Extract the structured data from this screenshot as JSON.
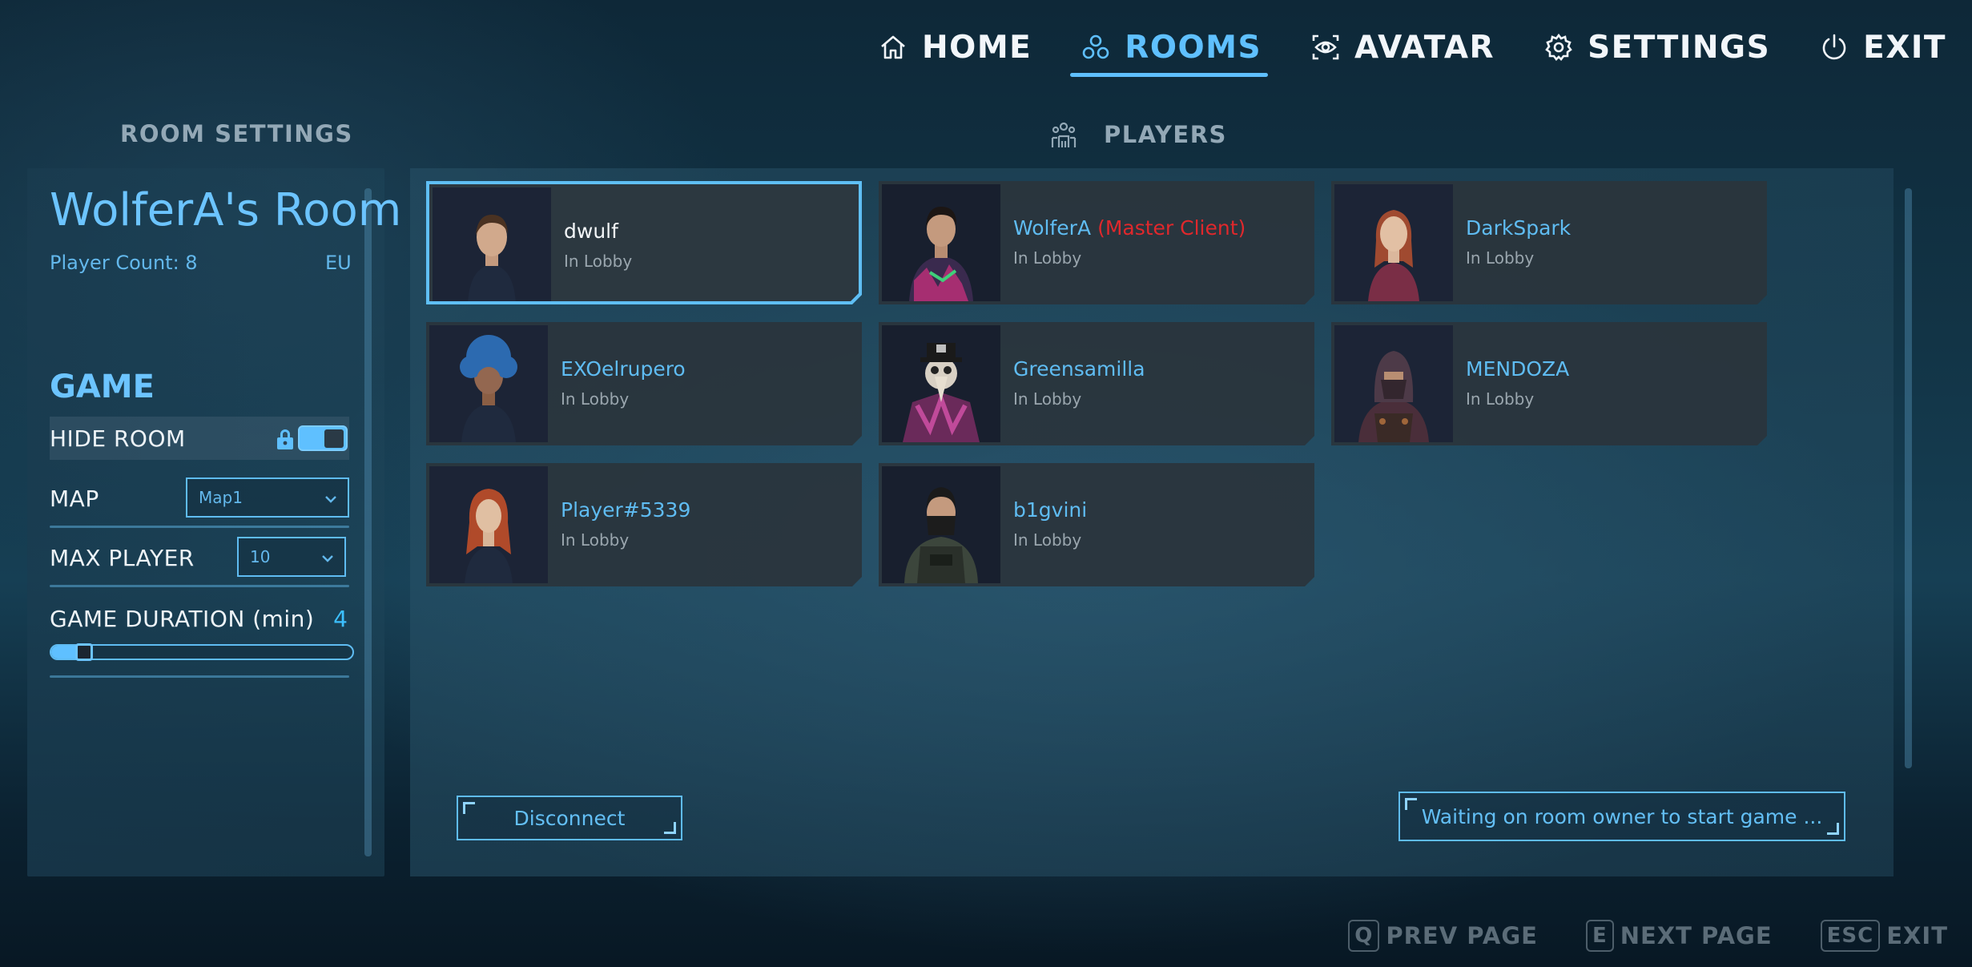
{
  "nav": {
    "items": [
      {
        "label": "HOME",
        "icon": "home-icon",
        "active": false
      },
      {
        "label": "ROOMS",
        "icon": "rooms-icon",
        "active": true
      },
      {
        "label": "AVATAR",
        "icon": "avatar-eye-icon",
        "active": false
      },
      {
        "label": "SETTINGS",
        "icon": "gear-icon",
        "active": false
      },
      {
        "label": "EXIT",
        "icon": "power-icon",
        "active": false
      }
    ],
    "accent_color": "#5fc0ff"
  },
  "room_settings": {
    "section_title": "ROOM SETTINGS",
    "room_name": "WolferA's Room",
    "player_count": "Player Count: 8",
    "region": "EU",
    "game_title": "GAME",
    "hide_room": {
      "label": "HIDE ROOM",
      "enabled": true,
      "locked": true
    },
    "map": {
      "label": "MAP",
      "value": "Map1"
    },
    "max_player": {
      "label": "MAX PLAYER",
      "value": "10"
    },
    "game_duration": {
      "label": "GAME DURATION (min)",
      "value": "4",
      "slider_fraction": 0.08
    }
  },
  "players": {
    "section_title": "PLAYERS",
    "list": [
      {
        "name": "dwulf",
        "status": "In Lobby",
        "tag": "",
        "selected": true
      },
      {
        "name": "WolferA",
        "status": "In Lobby",
        "tag": "(Master Client)",
        "selected": false
      },
      {
        "name": "DarkSpark",
        "status": "In Lobby",
        "tag": "",
        "selected": false
      },
      {
        "name": "EXOelrupero",
        "status": "In Lobby",
        "tag": "",
        "selected": false
      },
      {
        "name": "Greensamilla",
        "status": "In Lobby",
        "tag": "",
        "selected": false
      },
      {
        "name": "MENDOZA",
        "status": "In Lobby",
        "tag": "",
        "selected": false
      },
      {
        "name": "Player#5339",
        "status": "In Lobby",
        "tag": "",
        "selected": false
      },
      {
        "name": "b1gvini",
        "status": "In Lobby",
        "tag": "",
        "selected": false
      }
    ]
  },
  "buttons": {
    "disconnect": "Disconnect",
    "waiting": "Waiting on room owner to start game ..."
  },
  "footer": {
    "hints": [
      {
        "key": "Q",
        "label": "PREV PAGE"
      },
      {
        "key": "E",
        "label": "NEXT PAGE"
      },
      {
        "key": "ESC",
        "label": "EXIT"
      }
    ]
  }
}
